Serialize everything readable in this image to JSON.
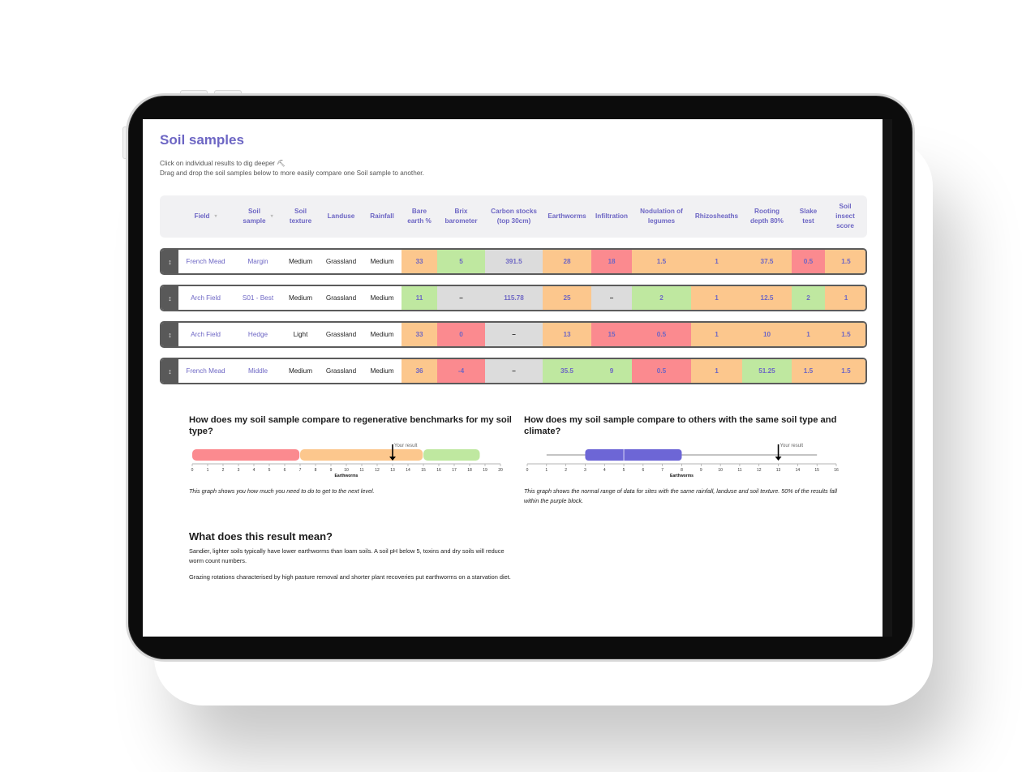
{
  "page": {
    "title": "Soil samples",
    "subtitle_line1": "Click on individual results to dig deeper ⛏",
    "subtitle_line2": "Drag and drop the soil samples below to more easily compare one Soil sample to another."
  },
  "table": {
    "columns": [
      {
        "key": "field",
        "label_lines": [
          "Field"
        ],
        "sortable": true
      },
      {
        "key": "sample",
        "label_lines": [
          "Soil",
          "sample"
        ],
        "sortable": true
      },
      {
        "key": "texture",
        "label_lines": [
          "Soil",
          "texture"
        ]
      },
      {
        "key": "landuse",
        "label_lines": [
          "Landuse"
        ]
      },
      {
        "key": "rainfall",
        "label_lines": [
          "Rainfall"
        ]
      },
      {
        "key": "bare_earth",
        "label_lines": [
          "Bare",
          "earth %"
        ]
      },
      {
        "key": "brix",
        "label_lines": [
          "Brix",
          "barometer"
        ]
      },
      {
        "key": "carbon",
        "label_lines": [
          "Carbon stocks",
          "(top 30cm)"
        ]
      },
      {
        "key": "earthworms",
        "label_lines": [
          "Earthworms"
        ]
      },
      {
        "key": "infiltration",
        "label_lines": [
          "Infiltration"
        ]
      },
      {
        "key": "nodulation",
        "label_lines": [
          "Nodulation of",
          "legumes"
        ]
      },
      {
        "key": "rhizosheaths",
        "label_lines": [
          "Rhizosheaths"
        ]
      },
      {
        "key": "rooting",
        "label_lines": [
          "Rooting",
          "depth 80%"
        ]
      },
      {
        "key": "slake",
        "label_lines": [
          "Slake",
          "test"
        ]
      },
      {
        "key": "insect",
        "label_lines": [
          "Soil",
          "insect",
          "score"
        ]
      }
    ],
    "status_colors": {
      "good": "#bfe8a0",
      "fair": "#fcc78d",
      "poor": "#fb8a8f",
      "none": "#dcdcdc"
    },
    "rows": [
      {
        "field": "French Mead",
        "sample": "Margin",
        "texture": "Medium",
        "landuse": "Grassland",
        "rainfall": "Medium",
        "results": [
          {
            "value": "33",
            "status": "fair"
          },
          {
            "value": "5",
            "status": "good"
          },
          {
            "value": "391.5",
            "status": "none"
          },
          {
            "value": "28",
            "status": "fair"
          },
          {
            "value": "18",
            "status": "poor"
          },
          {
            "value": "1.5",
            "status": "fair"
          },
          {
            "value": "1",
            "status": "fair"
          },
          {
            "value": "37.5",
            "status": "fair"
          },
          {
            "value": "0.5",
            "status": "poor"
          },
          {
            "value": "1.5",
            "status": "fair"
          }
        ]
      },
      {
        "field": "Arch Field",
        "sample": "S01 - Best",
        "texture": "Medium",
        "landuse": "Grassland",
        "rainfall": "Medium",
        "results": [
          {
            "value": "11",
            "status": "good"
          },
          {
            "value": "–",
            "status": "none"
          },
          {
            "value": "115.78",
            "status": "none"
          },
          {
            "value": "25",
            "status": "fair"
          },
          {
            "value": "–",
            "status": "none"
          },
          {
            "value": "2",
            "status": "good"
          },
          {
            "value": "1",
            "status": "fair"
          },
          {
            "value": "12.5",
            "status": "fair"
          },
          {
            "value": "2",
            "status": "good"
          },
          {
            "value": "1",
            "status": "fair"
          }
        ]
      },
      {
        "field": "Arch Field",
        "sample": "Hedge",
        "texture": "Light",
        "landuse": "Grassland",
        "rainfall": "Medium",
        "results": [
          {
            "value": "33",
            "status": "fair"
          },
          {
            "value": "0",
            "status": "poor"
          },
          {
            "value": "–",
            "status": "none"
          },
          {
            "value": "13",
            "status": "fair"
          },
          {
            "value": "15",
            "status": "poor"
          },
          {
            "value": "0.5",
            "status": "poor"
          },
          {
            "value": "1",
            "status": "fair"
          },
          {
            "value": "10",
            "status": "fair"
          },
          {
            "value": "1",
            "status": "fair"
          },
          {
            "value": "1.5",
            "status": "fair"
          }
        ]
      },
      {
        "field": "French Mead",
        "sample": "Middle",
        "texture": "Medium",
        "landuse": "Grassland",
        "rainfall": "Medium",
        "results": [
          {
            "value": "36",
            "status": "fair"
          },
          {
            "value": "-4",
            "status": "poor"
          },
          {
            "value": "–",
            "status": "none"
          },
          {
            "value": "35.5",
            "status": "good"
          },
          {
            "value": "9",
            "status": "good"
          },
          {
            "value": "0.5",
            "status": "poor"
          },
          {
            "value": "1",
            "status": "fair"
          },
          {
            "value": "51.25",
            "status": "good"
          },
          {
            "value": "1.5",
            "status": "fair"
          },
          {
            "value": "1.5",
            "status": "fair"
          }
        ]
      }
    ]
  },
  "benchmark": {
    "heading": "How does my soil sample compare to regenerative benchmarks for my soil type?",
    "caption": "This graph shows you how much you need to do to get to the next level."
  },
  "comparison": {
    "heading": "How does my soil sample compare to others with the same soil type and climate?",
    "caption": "This graph shows the normal range of data for sites with the same rainfall, landuse and soil texture. 50% of the results fall within the purple block."
  },
  "meaning": {
    "heading": "What does this result mean?",
    "paragraph1": "Sandier, lighter soils typically have lower earthworms than loam soils. A soil pH below 5, toxins and dry soils will reduce worm count numbers.",
    "paragraph2": "Grazing rotations characterised by high pasture removal and shorter plant recoveries put earthworms on a starvation diet."
  },
  "chart_data": [
    {
      "type": "bar",
      "subtype": "banded-range",
      "title": "How does my soil sample compare to regenerative benchmarks for my soil type?",
      "xlabel": "Earthworms",
      "xlim": [
        0,
        20
      ],
      "xticks": [
        0,
        1,
        2,
        3,
        4,
        5,
        6,
        7,
        8,
        9,
        10,
        11,
        12,
        13,
        14,
        15,
        16,
        17,
        18,
        19,
        20
      ],
      "bands": [
        {
          "name": "poor",
          "from": 0,
          "to": 7,
          "color": "#fb8a8f"
        },
        {
          "name": "fair",
          "from": 7,
          "to": 15,
          "color": "#fcc78d"
        },
        {
          "name": "good",
          "from": 15,
          "to": 18.7,
          "color": "#bfe8a0"
        }
      ],
      "marker": {
        "label": "Your result",
        "value": 13
      }
    },
    {
      "type": "boxplot",
      "title": "How does my soil sample compare to others with the same soil type and climate?",
      "xlabel": "Earthworms",
      "xlim": [
        0,
        16
      ],
      "xticks": [
        0,
        1,
        2,
        3,
        4,
        5,
        6,
        7,
        8,
        9,
        10,
        11,
        12,
        13,
        14,
        15,
        16
      ],
      "whisker_low": 1,
      "q1": 3,
      "median": 5,
      "q3": 8,
      "whisker_high": 15,
      "box_color": "#6d66d6",
      "marker": {
        "label": "Your result",
        "value": 13
      }
    }
  ]
}
